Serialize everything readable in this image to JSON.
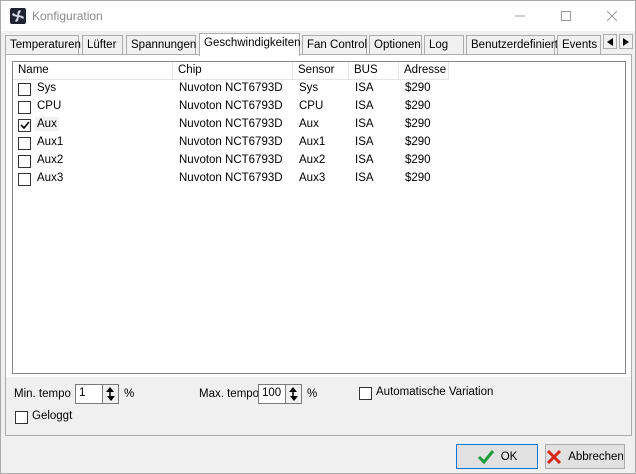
{
  "window": {
    "title": "Konfiguration"
  },
  "tabs": [
    {
      "label": "Temperaturen"
    },
    {
      "label": "Lüfter"
    },
    {
      "label": "Spannungen"
    },
    {
      "label": "Geschwindigkeiten",
      "active": true
    },
    {
      "label": "Fan Control"
    },
    {
      "label": "Optionen"
    },
    {
      "label": "Log"
    },
    {
      "label": "Benutzerdefiniert"
    },
    {
      "label": "Events"
    }
  ],
  "list": {
    "columns": [
      "Name",
      "Chip",
      "Sensor",
      "BUS",
      "Adresse"
    ],
    "rows": [
      {
        "checked": false,
        "name": "Sys",
        "chip": "Nuvoton NCT6793D",
        "sensor": "Sys",
        "bus": "ISA",
        "address": "$290"
      },
      {
        "checked": false,
        "name": "CPU",
        "chip": "Nuvoton NCT6793D",
        "sensor": "CPU",
        "bus": "ISA",
        "address": "$290"
      },
      {
        "checked": true,
        "name": "Aux",
        "chip": "Nuvoton NCT6793D",
        "sensor": "Aux",
        "bus": "ISA",
        "address": "$290"
      },
      {
        "checked": false,
        "name": "Aux1",
        "chip": "Nuvoton NCT6793D",
        "sensor": "Aux1",
        "bus": "ISA",
        "address": "$290"
      },
      {
        "checked": false,
        "name": "Aux2",
        "chip": "Nuvoton NCT6793D",
        "sensor": "Aux2",
        "bus": "ISA",
        "address": "$290"
      },
      {
        "checked": false,
        "name": "Aux3",
        "chip": "Nuvoton NCT6793D",
        "sensor": "Aux3",
        "bus": "ISA",
        "address": "$290"
      }
    ]
  },
  "controls": {
    "min_tempo_label": "Min. tempo",
    "min_tempo_value": "1",
    "min_tempo_unit": "%",
    "max_tempo_label": "Max. tempo",
    "max_tempo_value": "100",
    "max_tempo_unit": "%",
    "auto_variation_label": "Automatische Variation",
    "auto_variation_checked": false,
    "logged_label": "Geloggt",
    "logged_checked": false
  },
  "buttons": {
    "ok": "OK",
    "cancel": "Abbrechen"
  },
  "colors": {
    "ok_check": "#1e9e3a",
    "cancel_x": "#d9261c",
    "ok_border": "#0078d7"
  }
}
